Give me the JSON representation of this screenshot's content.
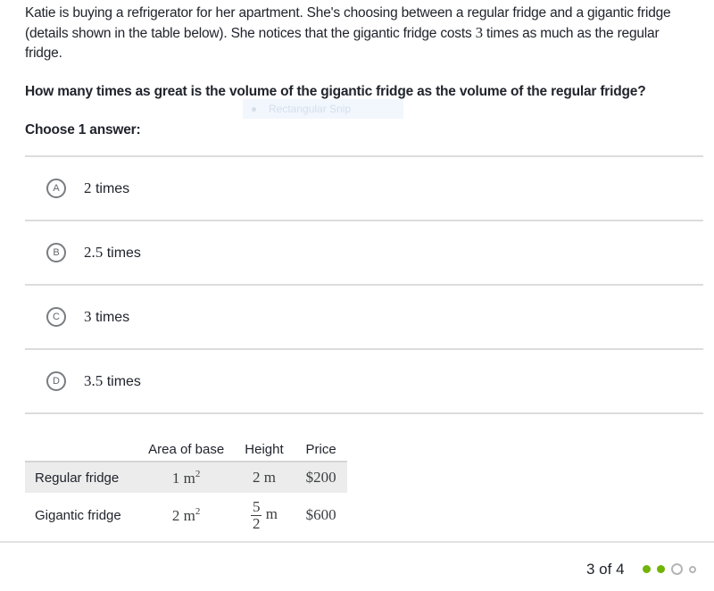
{
  "intro": {
    "part1": "Katie is buying a refrigerator for her apartment. She's choosing between a regular fridge and a gigantic fridge (details shown in the table below). She notices that the gigantic fridge costs ",
    "multiplier": "3",
    "part2": " times as much as the regular fridge."
  },
  "question": "How many times as great is the volume of the gigantic fridge as the volume of the regular fridge?",
  "overlay": {
    "snip_label": "Rectangular Snip"
  },
  "choose_label": "Choose 1 answer:",
  "choices": [
    {
      "letter": "A",
      "value": "2",
      "unit": " times"
    },
    {
      "letter": "B",
      "value": "2.5",
      "unit": " times"
    },
    {
      "letter": "C",
      "value": "3",
      "unit": " times"
    },
    {
      "letter": "D",
      "value": "3.5",
      "unit": " times"
    }
  ],
  "table": {
    "headers": [
      "",
      "Area of base",
      "Height",
      "Price"
    ],
    "rows": [
      {
        "label": "Regular fridge",
        "area_value": "1",
        "area_unit": "m",
        "area_exp": "2",
        "height": "2 m",
        "price": "$200"
      },
      {
        "label": "Gigantic fridge",
        "area_value": "2",
        "area_unit": "m",
        "area_exp": "2",
        "height_num": "5",
        "height_den": "2",
        "height_unit": "m",
        "price": "$600"
      }
    ]
  },
  "progress": {
    "label": "3 of 4",
    "current": 3,
    "total": 4,
    "done_color": "#71b307",
    "pending_color": "#b5b5b5"
  }
}
